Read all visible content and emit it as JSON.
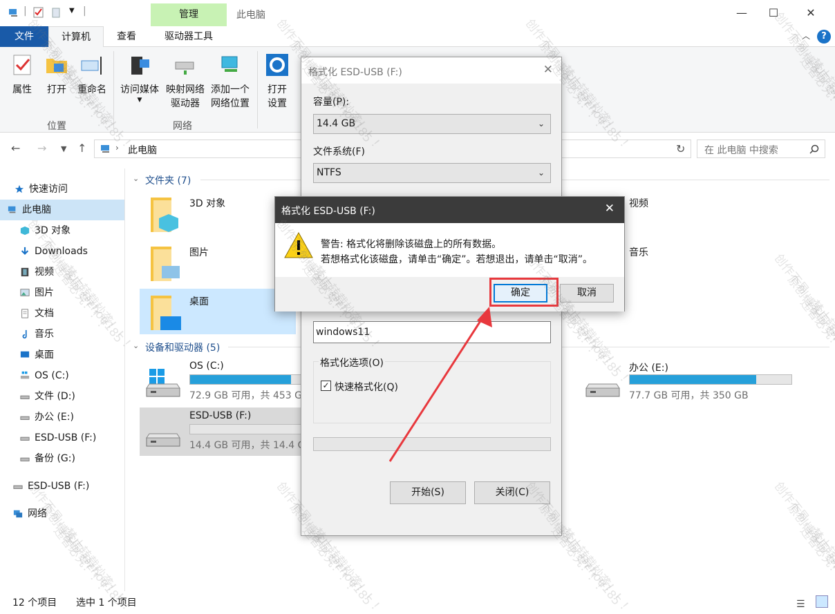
{
  "window": {
    "title": "此电脑",
    "context_tab": "管理",
    "minimize": "—",
    "maximize": "☐",
    "close": "✕"
  },
  "ribbon_tabs": {
    "file": "文件",
    "computer": "计算机",
    "view": "查看",
    "drive_tools": "驱动器工具"
  },
  "ribbon": {
    "properties": "属性",
    "open": "打开",
    "rename": "重命名",
    "access_media": "访问媒体",
    "map_drive_l1": "映射网络",
    "map_drive_l2": "驱动器",
    "add_location_l1": "添加一个",
    "add_location_l2": "网络位置",
    "open_settings_l1": "打开",
    "open_settings_l2": "设置",
    "group_location": "位置",
    "group_network": "网络"
  },
  "address": {
    "path": "此电脑",
    "search_placeholder": "在 此电脑 中搜索"
  },
  "nav": {
    "items": [
      {
        "label": "快速访问"
      },
      {
        "label": "此电脑"
      },
      {
        "label": "3D 对象"
      },
      {
        "label": "Downloads"
      },
      {
        "label": "视频"
      },
      {
        "label": "图片"
      },
      {
        "label": "文档"
      },
      {
        "label": "音乐"
      },
      {
        "label": "桌面"
      },
      {
        "label": "OS (C:)"
      },
      {
        "label": "文件 (D:)"
      },
      {
        "label": "办公 (E:)"
      },
      {
        "label": "ESD-USB (F:)"
      },
      {
        "label": "备份 (G:)"
      },
      {
        "label": "ESD-USB (F:)"
      },
      {
        "label": "网络"
      }
    ]
  },
  "content": {
    "folders_header": "文件夹 (7)",
    "devices_header": "设备和驱动器 (5)",
    "folders": [
      {
        "name": "3D 对象"
      },
      {
        "name": "视频"
      },
      {
        "name": "图片"
      },
      {
        "name": "音乐"
      },
      {
        "name": "桌面"
      }
    ],
    "drives": [
      {
        "name": "OS (C:)",
        "free": "72.9 GB 可用，共 453 G",
        "used": 0.84
      },
      {
        "name": "办公 (E:)",
        "free": "77.7 GB 可用，共 350 GB",
        "used": 0.78
      },
      {
        "name": "ESD-USB (F:)",
        "free": "14.4 GB 可用，共 14.4 G",
        "used": 0.0
      }
    ]
  },
  "status": {
    "count": "12 个项目",
    "selected": "选中 1 个项目"
  },
  "format_dialog": {
    "title": "格式化 ESD-USB (F:)",
    "capacity_label": "容量(P):",
    "capacity_value": "14.4 GB",
    "fs_label": "文件系统(F)",
    "fs_value": "NTFS",
    "volume_label_value": "windows11",
    "options_label": "格式化选项(O)",
    "quick_format": "快速格式化(Q)",
    "start": "开始(S)",
    "close": "关闭(C)"
  },
  "warning_dialog": {
    "title": "格式化 ESD-USB (F:)",
    "line1": "警告: 格式化将删除该磁盘上的所有数据。",
    "line2": "若想格式化该磁盘，请单击“确定”。若想退出，请单击“取消”。",
    "ok": "确定",
    "cancel": "取消"
  },
  "watermark": {
    "line1": "创作不易，禁止转载抄袭！！！",
    "line2": "原创博客园 @zhou185",
    "line3": "违者必究！！！"
  },
  "colors": {
    "file_tab": "#195aa8",
    "selection": "#cce8ff",
    "drive_bar": "#26a0da",
    "highlight": "#e8383d",
    "context_tab": "#c8f2b4"
  }
}
